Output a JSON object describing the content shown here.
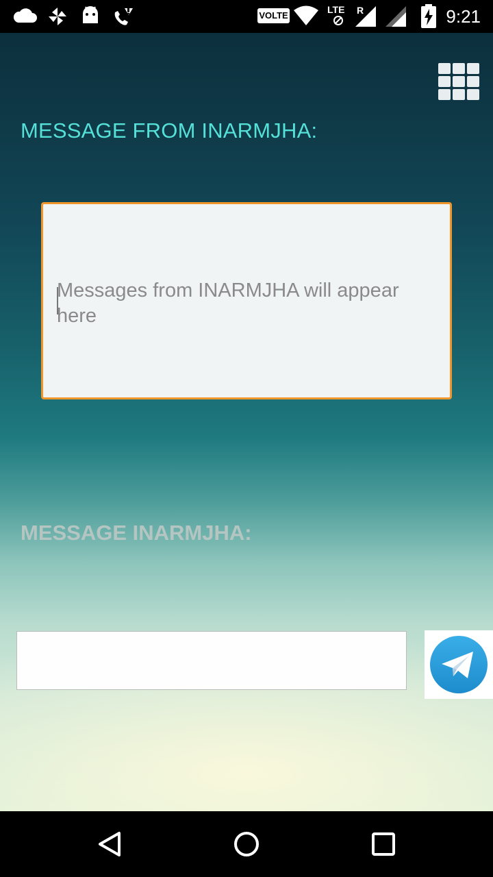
{
  "status_bar": {
    "time": "9:21",
    "volte": "VOLTE",
    "lte": "LTE",
    "roaming": "R",
    "icons": [
      "cloud-icon",
      "pinwheel-icon",
      "android-icon",
      "wifi-call-icon",
      "wifi-icon",
      "signal-icon",
      "signal-icon-2",
      "battery-charging-icon"
    ]
  },
  "app": {
    "menu_icon": "grid-menu-icon",
    "label_from": "MESSAGE FROM INARMJHA:",
    "message_box": {
      "placeholder": "Messages from INARMJHA will appear here"
    },
    "label_to": "MESSAGE INARMJHA:",
    "input": {
      "value": "",
      "placeholder": ""
    },
    "send_icon": "telegram-send-icon"
  },
  "nav_bar": {
    "icons": [
      "back-icon",
      "home-icon",
      "recents-icon"
    ]
  },
  "colors": {
    "accent": "#f0952a",
    "label_from": "#55e0d8",
    "label_to": "#b5c5c2",
    "telegram": "#2c9fd9"
  }
}
